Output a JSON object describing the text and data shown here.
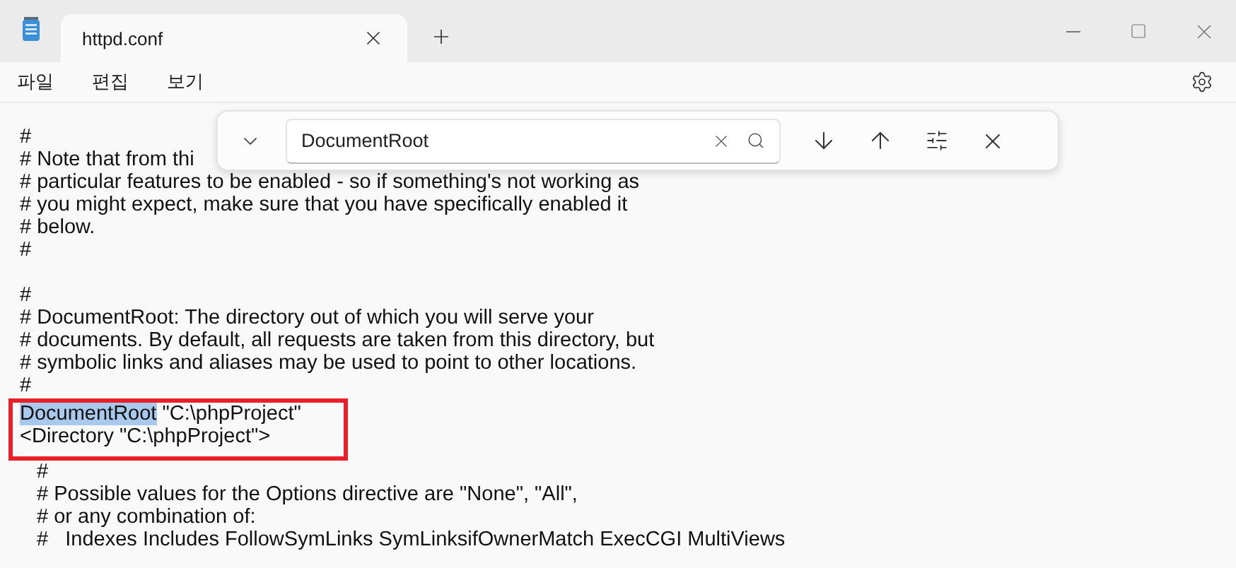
{
  "tab": {
    "title": "httpd.conf",
    "selected": true
  },
  "menu": [
    "파일",
    "편집",
    "보기"
  ],
  "find": {
    "value": "DocumentRoot"
  },
  "paragraphs": [
    {
      "lines": [
        {
          "text": "#",
          "indented": false
        },
        {
          "text": "# Note that from thi",
          "indented": false
        },
        {
          "text": "# particular features to be enabled - so if something's not working as",
          "indented": false
        },
        {
          "text": "# you might expect, make sure that you have specifically enabled it",
          "indented": false
        },
        {
          "text": "# below.",
          "indented": false
        },
        {
          "text": "#",
          "indented": false
        }
      ]
    },
    {
      "lines": [
        {
          "text": "#",
          "indented": false
        },
        {
          "text": "# DocumentRoot: The directory out of which you will serve your",
          "indented": false
        },
        {
          "text": "# documents. By default, all requests are taken from this directory, but",
          "indented": false
        },
        {
          "text": "# symbolic links and aliases may be used to point to other locations.",
          "indented": false
        },
        {
          "text": "#",
          "indented": false
        }
      ]
    }
  ],
  "marked_lines": [
    {
      "match": "DocumentRoot",
      "text": " \"C:\\phpProject\""
    },
    {
      "text": "<Directory \"C:\\phpProject\">"
    }
  ],
  "lines_after": [
    {
      "text": "#",
      "indented": true
    },
    {
      "text": "# Possible values for the Options directive are \"None\", \"All\",",
      "indented": true
    },
    {
      "text": "# or any combination of:",
      "indented": true
    },
    {
      "text": "#   Indexes Includes FollowSymLinks SymLinksifOwnerMatch ExecCGI MultiViews",
      "indented": true
    }
  ]
}
